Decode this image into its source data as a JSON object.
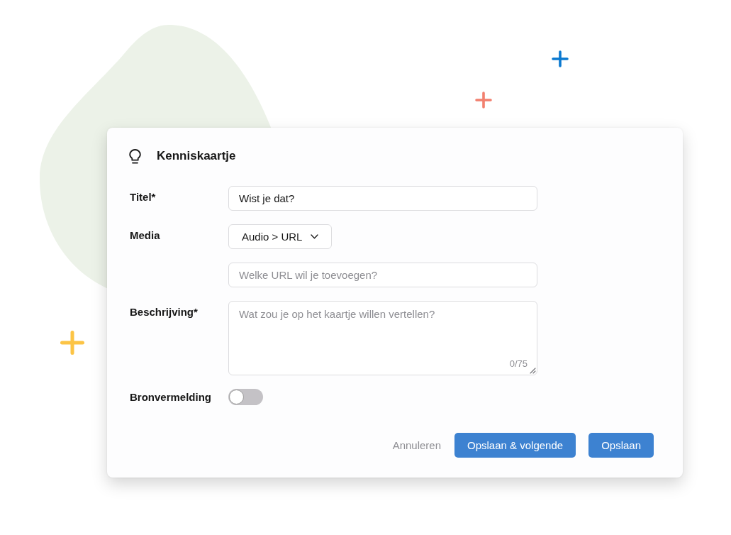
{
  "dialog": {
    "title": "Kenniskaartje",
    "fields": [
      {
        "kind": "text",
        "label": "Titel*",
        "value": "Wist je dat?"
      },
      {
        "kind": "select",
        "label": "Media",
        "value": "Audio > URL"
      },
      {
        "kind": "text",
        "placeholder": "Welke URL wil je toevoegen?"
      },
      {
        "kind": "textarea",
        "label": "Beschrijving*",
        "placeholder": "Wat zou je op het kaartje willen vertellen?",
        "counter": "0/75"
      },
      {
        "kind": "toggle",
        "label": "Bronvermelding",
        "on": false
      }
    ],
    "buttons": [
      {
        "kind": "plain",
        "label": "Annuleren"
      },
      {
        "kind": "primary",
        "label": "Opslaan & volgende"
      },
      {
        "kind": "primary",
        "label": "Opslaan"
      }
    ]
  }
}
